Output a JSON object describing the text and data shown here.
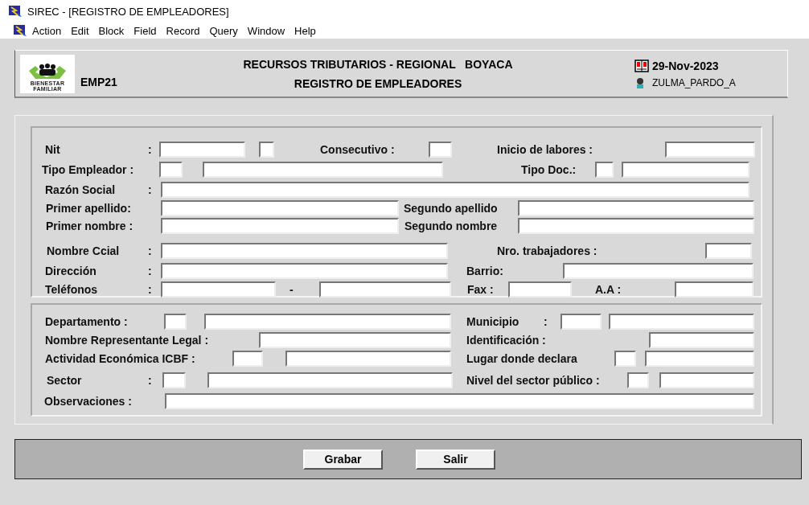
{
  "window": {
    "title": "SIREC - [REGISTRO DE EMPLEADORES]"
  },
  "menu": [
    "Action",
    "Edit",
    "Block",
    "Field",
    "Record",
    "Query",
    "Window",
    "Help"
  ],
  "header": {
    "logo": [
      "BIENESTAR",
      "FAMILIAR"
    ],
    "code": "EMP21",
    "title_lines": [
      "RECURSOS TRIBUTARIOS - REGIONAL   BOYACA",
      "REGISTRO DE EMPLEADORES"
    ],
    "date": "29-Nov-2023",
    "user": "ZULMA_PARDO_A"
  },
  "sections": [
    {
      "rows": [
        {
          "items": [
            {
              "kind": "label",
              "text": "Nit"
            },
            {
              "kind": "label",
              "text": ":"
            },
            {
              "kind": "field"
            },
            {
              "kind": "field"
            },
            {
              "kind": "label",
              "text": "Consecutivo :"
            },
            {
              "kind": "field"
            },
            {
              "kind": "label",
              "text": "Inicio de labores :"
            },
            {
              "kind": "field"
            }
          ]
        },
        {
          "items": [
            {
              "kind": "label",
              "text": "Tipo Empleador :"
            },
            {
              "kind": "field"
            },
            {
              "kind": "field"
            },
            {
              "kind": "label",
              "text": "Tipo Doc.:"
            },
            {
              "kind": "field"
            },
            {
              "kind": "field"
            }
          ]
        },
        {
          "items": [
            {
              "kind": "label",
              "text": "Razón Social"
            },
            {
              "kind": "label",
              "text": ":"
            },
            {
              "kind": "field"
            }
          ]
        },
        {
          "items": [
            {
              "kind": "label",
              "text": "Primer apellido:"
            },
            {
              "kind": "field"
            },
            {
              "kind": "label",
              "text": "Segundo apellido"
            },
            {
              "kind": "field"
            }
          ]
        },
        {
          "items": [
            {
              "kind": "label",
              "text": "Primer nombre :"
            },
            {
              "kind": "field"
            },
            {
              "kind": "label",
              "text": "Segundo nombre"
            },
            {
              "kind": "field"
            }
          ]
        },
        {
          "items": [
            {
              "kind": "label",
              "text": "Nombre Ccial"
            },
            {
              "kind": "label",
              "text": ":"
            },
            {
              "kind": "field"
            },
            {
              "kind": "label",
              "text": "Nro. trabajadores :"
            },
            {
              "kind": "field"
            }
          ]
        },
        {
          "items": [
            {
              "kind": "label",
              "text": "Dirección"
            },
            {
              "kind": "label",
              "text": ":"
            },
            {
              "kind": "field"
            },
            {
              "kind": "label",
              "text": "Barrio:"
            },
            {
              "kind": "field"
            }
          ]
        },
        {
          "items": [
            {
              "kind": "label",
              "text": "Teléfonos"
            },
            {
              "kind": "label",
              "text": ":"
            },
            {
              "kind": "field"
            },
            {
              "kind": "label",
              "text": "-"
            },
            {
              "kind": "field"
            },
            {
              "kind": "label",
              "text": "Fax :"
            },
            {
              "kind": "field"
            },
            {
              "kind": "label",
              "text": "A.A :"
            },
            {
              "kind": "field"
            }
          ]
        }
      ]
    },
    {
      "rows": [
        {
          "items": [
            {
              "kind": "label",
              "text": "Departamento :"
            },
            {
              "kind": "field"
            },
            {
              "kind": "field"
            },
            {
              "kind": "label",
              "text": "Municipio"
            },
            {
              "kind": "label",
              "text": ":"
            },
            {
              "kind": "field"
            },
            {
              "kind": "field"
            }
          ]
        },
        {
          "items": [
            {
              "kind": "label",
              "text": "Nombre Representante Legal :"
            },
            {
              "kind": "field"
            },
            {
              "kind": "label",
              "text": "Identificación :"
            },
            {
              "kind": "field"
            }
          ]
        },
        {
          "items": [
            {
              "kind": "label",
              "text": "Actividad Económica ICBF :"
            },
            {
              "kind": "field"
            },
            {
              "kind": "field"
            },
            {
              "kind": "label",
              "text": "Lugar donde declara"
            },
            {
              "kind": "field"
            },
            {
              "kind": "field"
            }
          ]
        },
        {
          "items": [
            {
              "kind": "label",
              "text": "Sector"
            },
            {
              "kind": "label",
              "text": ":"
            },
            {
              "kind": "field"
            },
            {
              "kind": "field"
            },
            {
              "kind": "label",
              "text": "Nivel del sector público :"
            },
            {
              "kind": "field"
            },
            {
              "kind": "field"
            }
          ]
        },
        {
          "items": [
            {
              "kind": "label",
              "text": "Observaciones :"
            },
            {
              "kind": "field"
            }
          ]
        }
      ]
    }
  ],
  "buttons": [
    "Grabar",
    "Salir"
  ]
}
